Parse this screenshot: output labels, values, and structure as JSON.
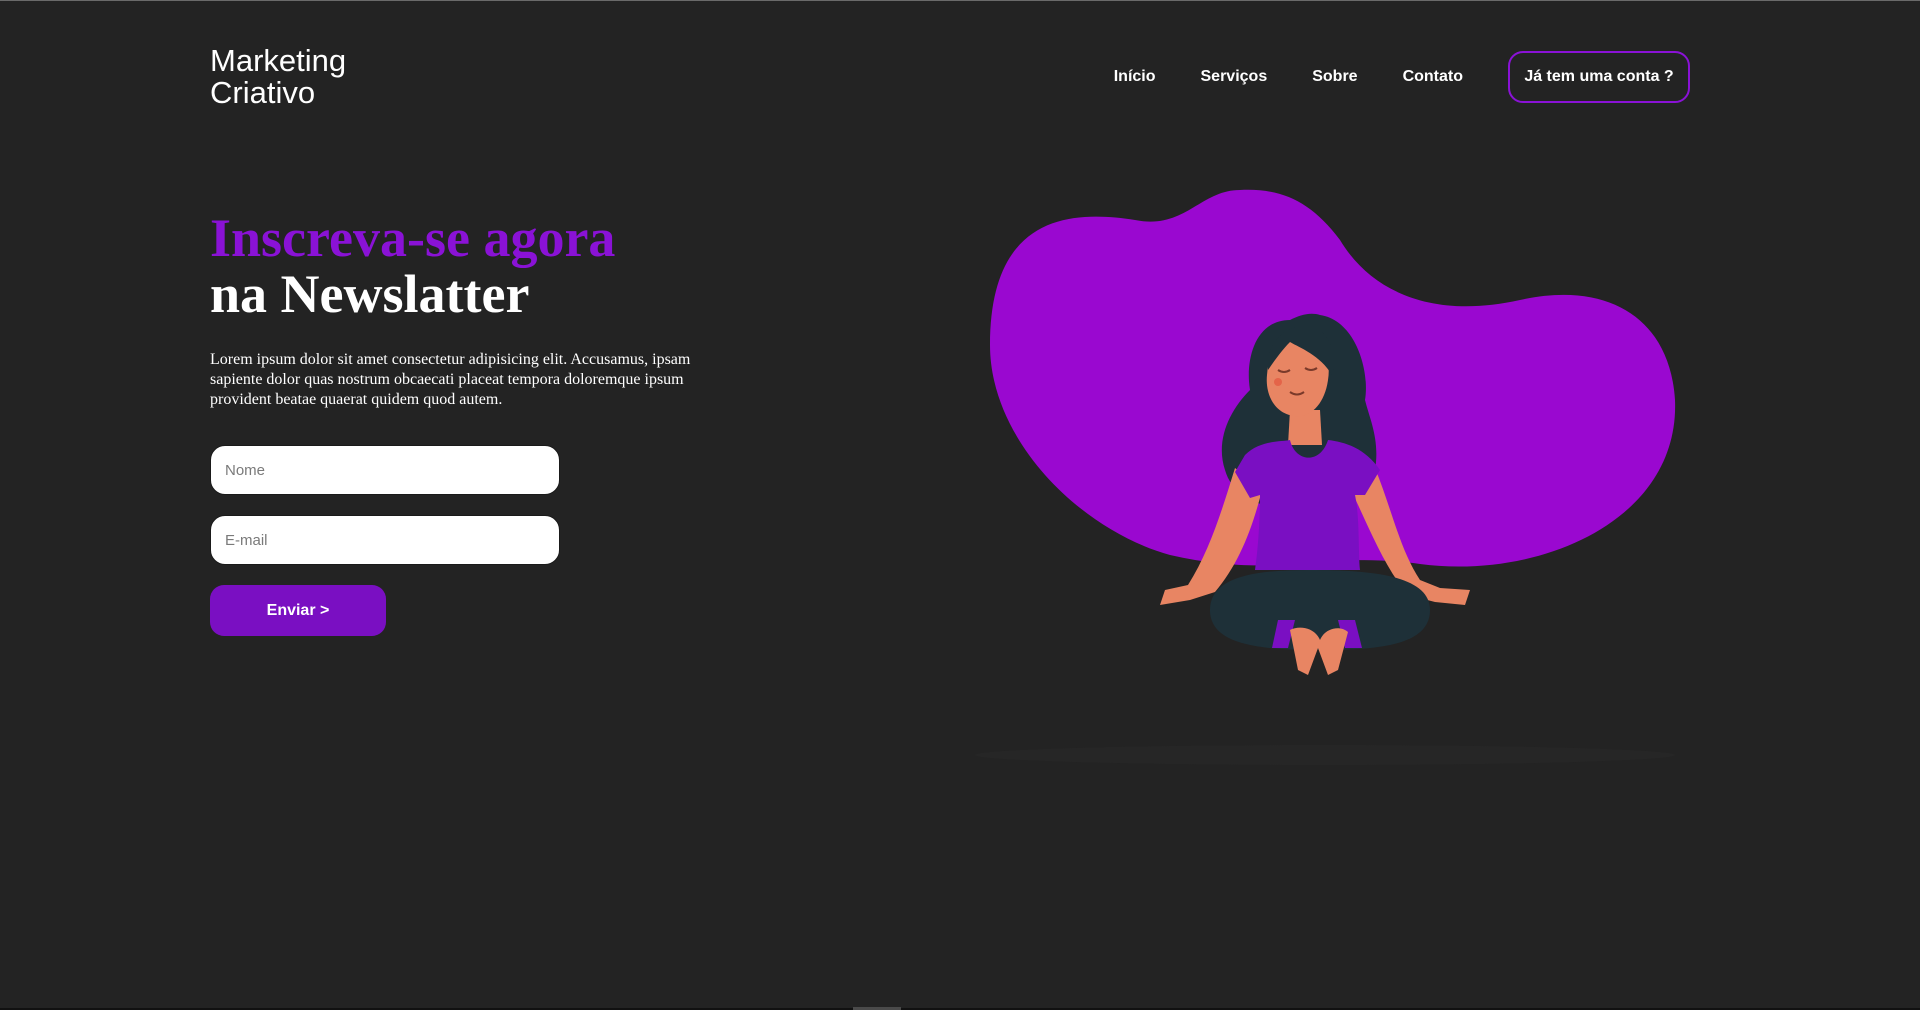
{
  "header": {
    "logo_line1": "Marketing",
    "logo_line2": "Criativo",
    "nav": {
      "inicio": "Início",
      "servicos": "Serviços",
      "sobre": "Sobre",
      "contato": "Contato",
      "account": "Já tem uma conta ?"
    }
  },
  "hero": {
    "title_accent": "Inscreva-se agora",
    "title_plain": "na Newslatter",
    "description": "Lorem ipsum dolor sit amet consectetur adipisicing elit. Accusamus, ipsam sapiente dolor quas nostrum obcaecati placeat tempora doloremque ipsum provident beatae quaerat quidem quod autem.",
    "form": {
      "name_placeholder": "Nome",
      "email_placeholder": "E-mail",
      "submit_label": "Enviar >"
    }
  },
  "colors": {
    "background": "#232323",
    "accent": "#8a12d6",
    "blob": "#9a08d0",
    "button": "#7a0fc2",
    "skin": "#e88563",
    "hair_pants": "#1e3038"
  },
  "icons": {
    "illustration": "meditating-woman-illustration"
  }
}
